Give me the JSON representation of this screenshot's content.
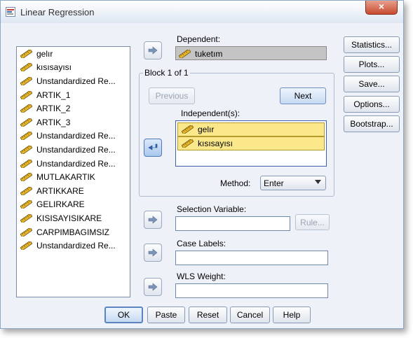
{
  "window": {
    "title": "Linear Regression",
    "close_glyph": "×"
  },
  "variables": [
    "gelır",
    "kısısayısı",
    "Unstandardized Re...",
    "ARTIK_1",
    "ARTIK_2",
    "ARTIK_3",
    "Unstandardized Re...",
    "Unstandardized Re...",
    "Unstandardized Re...",
    "MUTLAKARTIK",
    "ARTIKKARE",
    "GELIRKARE",
    "KISISAYISIKARE",
    "CARPIMBAGIMSIZ",
    "Unstandardized Re..."
  ],
  "dependent": {
    "label": "Dependent:",
    "value": "tuketım"
  },
  "block": {
    "title": "Block 1 of 1",
    "previous": "Previous",
    "next": "Next"
  },
  "independents": {
    "label": "Independent(s):",
    "items": [
      "gelır",
      "kısısayısı"
    ]
  },
  "method": {
    "label": "Method:",
    "value": "Enter"
  },
  "selection": {
    "label": "Selection Variable:",
    "rule": "Rule..."
  },
  "case_labels": {
    "label": "Case Labels:"
  },
  "wls": {
    "label": "WLS Weight:"
  },
  "side_buttons": {
    "statistics": "Statistics...",
    "plots": "Plots...",
    "save": "Save...",
    "options": "Options...",
    "bootstrap": "Bootstrap..."
  },
  "bottom_buttons": {
    "ok": "OK",
    "paste": "Paste",
    "reset": "Reset",
    "cancel": "Cancel",
    "help": "Help"
  },
  "colors": {
    "accent": "#4d79b4",
    "highlight": "#fbe88b",
    "window_bg": "#eef2f8",
    "ruler": "#d9a21b"
  }
}
